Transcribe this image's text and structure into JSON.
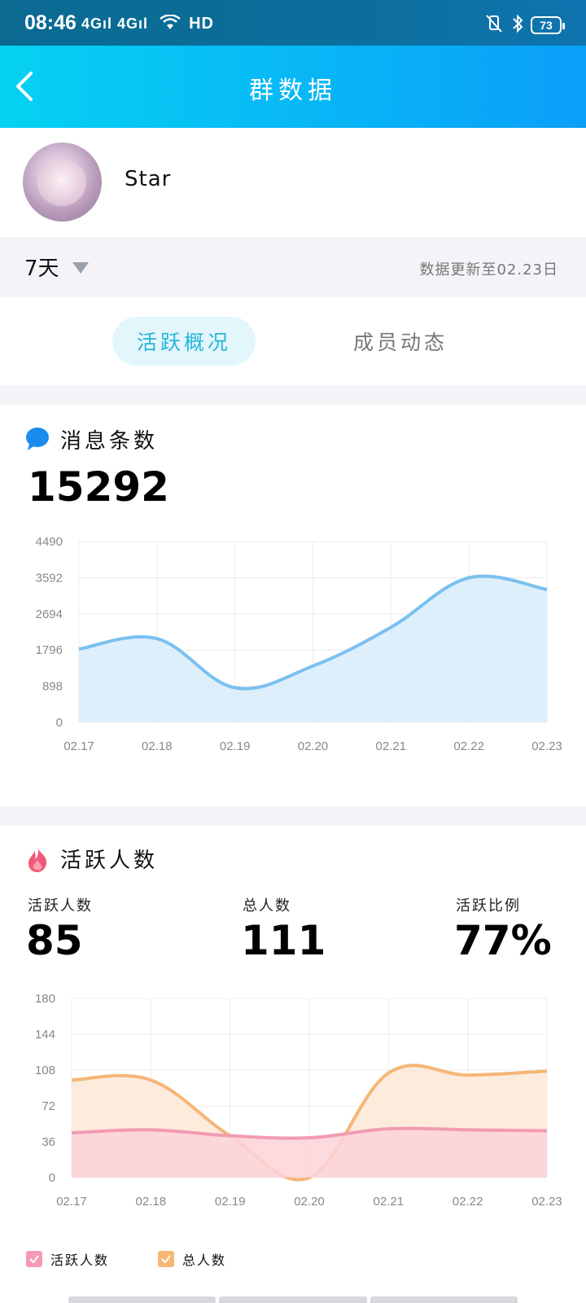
{
  "status_bar": {
    "time": "08:46",
    "network": "4Gıl 4Gıl",
    "hd": "HD",
    "battery": "73"
  },
  "header": {
    "title": "群数据"
  },
  "group": {
    "name": "Star"
  },
  "filter": {
    "range": "7天",
    "update_text": "数据更新至02.23日"
  },
  "tabs": [
    {
      "label": "活跃概况"
    },
    {
      "label": "成员动态"
    }
  ],
  "messages": {
    "title": "消息条数",
    "total": "15292",
    "icon_color": "#1a8cf0"
  },
  "activity": {
    "title": "活跃人数",
    "active_label": "活跃人数",
    "active_value": "85",
    "total_label": "总人数",
    "total_value": "111",
    "ratio_label": "活跃比例",
    "ratio_value": "77%",
    "icon_color": "#f05a78"
  },
  "legend": {
    "active": "活跃人数",
    "total": "总人数",
    "active_color": "#f59ab2",
    "total_color": "#f7b873"
  },
  "chart_data": [
    {
      "type": "area",
      "title": "消息条数",
      "x": [
        "02.17",
        "02.18",
        "02.19",
        "02.20",
        "02.21",
        "02.22",
        "02.23"
      ],
      "y_ticks": [
        "0",
        "898",
        "1796",
        "2694",
        "3592",
        "4490"
      ],
      "ylim": [
        0,
        4490
      ],
      "series": [
        {
          "values": [
            1820,
            2080,
            860,
            1400,
            2360,
            3590,
            3300
          ],
          "color": "#7ac0f0",
          "fill": "#d8ecfc"
        }
      ],
      "grid": true
    },
    {
      "type": "area",
      "title": "活跃人数",
      "x": [
        "02.17",
        "02.18",
        "02.19",
        "02.20",
        "02.21",
        "02.22",
        "02.23"
      ],
      "y_ticks": [
        "0",
        "36",
        "72",
        "108",
        "144",
        "180"
      ],
      "ylim": [
        0,
        180
      ],
      "series": [
        {
          "name": "活跃人数",
          "values": [
            45,
            48,
            42,
            40,
            49,
            48,
            47
          ],
          "color": "#f29bb3",
          "fill": "#fcd3d8"
        },
        {
          "name": "总人数",
          "values": [
            98,
            98,
            42,
            0,
            105,
            103,
            107
          ],
          "color": "#f5b677",
          "fill": "#fde8d6"
        }
      ],
      "grid": true,
      "legend": "bottom-left"
    }
  ]
}
